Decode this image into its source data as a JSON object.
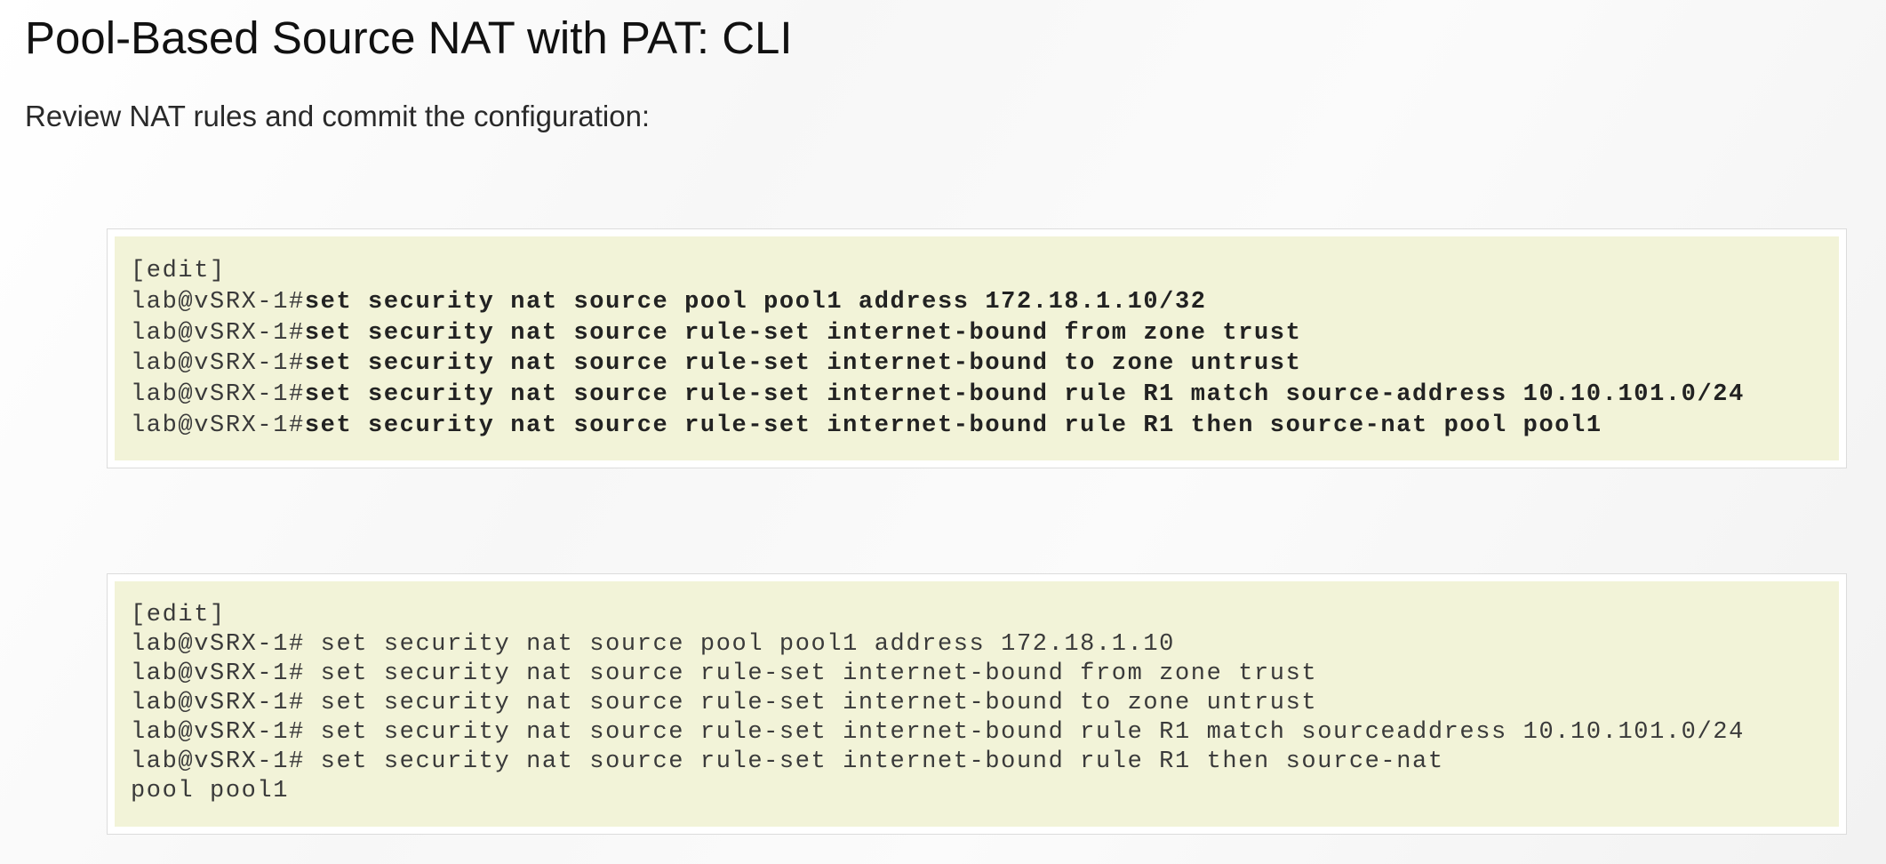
{
  "document": {
    "title": "Pool-Based Source NAT with PAT: CLI",
    "subtitle": "Review NAT rules and commit the configuration:"
  },
  "code_blocks": [
    {
      "lines": [
        {
          "prompt": "[edit]",
          "command": ""
        },
        {
          "prompt": "lab@vSRX-1#",
          "command": "set security nat source pool pool1 address 172.18.1.10/32"
        },
        {
          "prompt": "lab@vSRX-1#",
          "command": "set security nat source rule-set internet-bound from zone trust"
        },
        {
          "prompt": "lab@vSRX-1#",
          "command": "set security nat source rule-set internet-bound to zone untrust"
        },
        {
          "prompt": "lab@vSRX-1#",
          "command": "set security nat source rule-set internet-bound rule R1 match source-address 10.10.101.0/24"
        },
        {
          "prompt": "lab@vSRX-1#",
          "command": "set security nat source rule-set internet-bound rule R1 then source-nat pool pool1"
        }
      ]
    },
    {
      "lines": [
        {
          "prompt": "[edit]",
          "command": ""
        },
        {
          "prompt": "lab@vSRX-1#",
          "command": " set security nat source pool pool1 address 172.18.1.10"
        },
        {
          "prompt": "lab@vSRX-1#",
          "command": " set security nat source rule-set internet-bound from zone trust"
        },
        {
          "prompt": "lab@vSRX-1#",
          "command": " set security nat source rule-set internet-bound to zone untrust"
        },
        {
          "prompt": "lab@vSRX-1#",
          "command": " set security nat source rule-set internet-bound rule R1 match sourceaddress 10.10.101.0/24"
        },
        {
          "prompt": "lab@vSRX-1#",
          "command": " set security nat source rule-set internet-bound rule R1 then source-nat"
        },
        {
          "prompt": "pool pool1",
          "command": ""
        }
      ]
    }
  ]
}
